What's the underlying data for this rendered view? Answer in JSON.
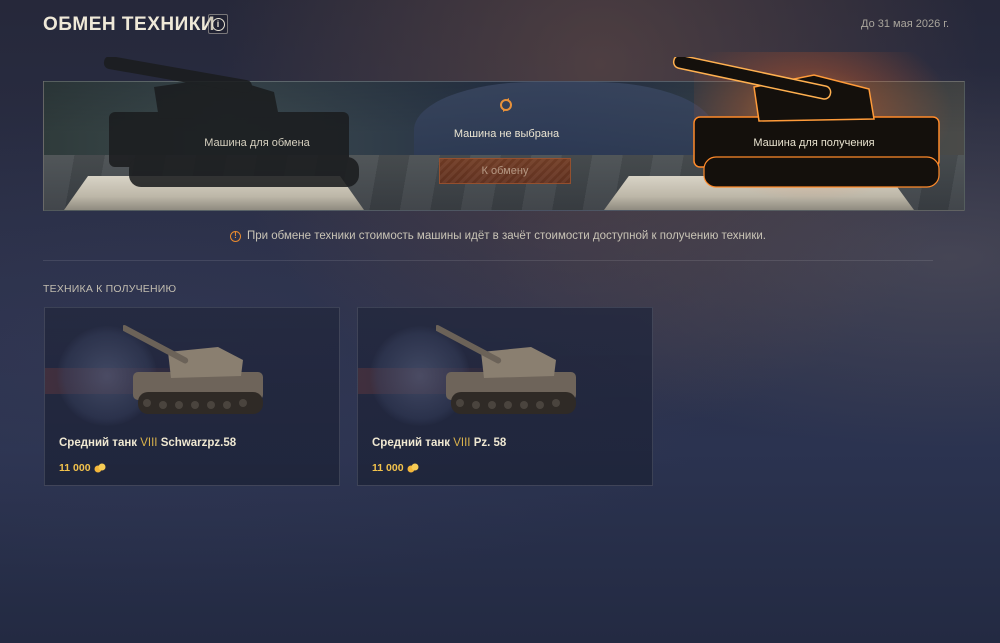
{
  "header": {
    "title": "ОБМЕН ТЕХНИКИ",
    "deadline": "До 31 мая 2026 г."
  },
  "exchange": {
    "slot_give_label": "Машина для обмена",
    "center_label": "Машина не выбрана",
    "exchange_button_label": "К обмену",
    "slot_receive_label": "Машина для получения"
  },
  "notice": {
    "text": "При обмене техники стоимость машины идёт в зачёт стоимости доступной к получению техники."
  },
  "section": {
    "title": "ТЕХНИКА К ПОЛУЧЕНИЮ"
  },
  "vehicles": [
    {
      "class_label": "Средний танк",
      "tier": "VIII",
      "name": "Schwarzpz.58",
      "price": "11 000",
      "currency_icon": "gold-icon"
    },
    {
      "class_label": "Средний танк",
      "tier": "VIII",
      "name": "Pz. 58",
      "price": "11 000",
      "currency_icon": "gold-icon"
    }
  ],
  "colors": {
    "accent_orange": "#e88a2f",
    "tier_gold": "#d9b24c",
    "price_gold": "#f3c34c"
  }
}
